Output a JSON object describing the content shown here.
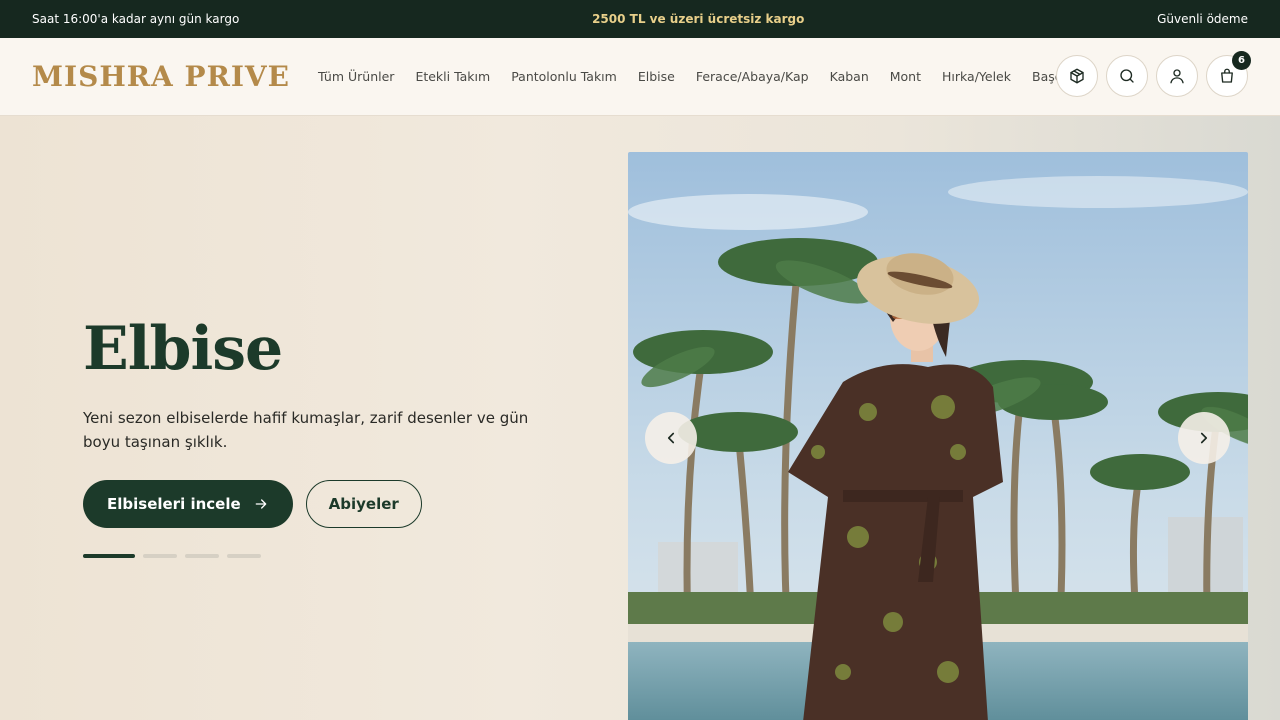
{
  "topbar": {
    "left": "Saat 16:00'a kadar aynı gün kargo",
    "center": "2500 TL ve üzeri ücretsiz kargo",
    "right": "Güvenli ödeme"
  },
  "header": {
    "logo": "MISHRA PRIVE",
    "nav": [
      "Tüm Ürünler",
      "Etekli Takım",
      "Pantolonlu Takım",
      "Elbise",
      "Ferace/Abaya/Kap",
      "Kaban",
      "Mont",
      "Hırka/Yelek",
      "Başörtü"
    ],
    "cart_count": "6"
  },
  "hero": {
    "title": "Elbise",
    "description": "Yeni sezon elbiselerde hafif kumaşlar, zarif desenler ve gün boyu taşınan şıklık.",
    "primary_button": "Elbiseleri incele",
    "secondary_button": "Abiyeler",
    "slide_count": 4,
    "active_slide": 1
  },
  "colors": {
    "dark_green": "#1c3a2a",
    "topbar": "#16281f",
    "gold": "#b48a4a",
    "promo": "#e8cf8a"
  },
  "icons": [
    "box-icon",
    "search-icon",
    "user-icon",
    "cart-icon",
    "arrow-right-icon",
    "chevron-left-icon",
    "chevron-right-icon"
  ]
}
